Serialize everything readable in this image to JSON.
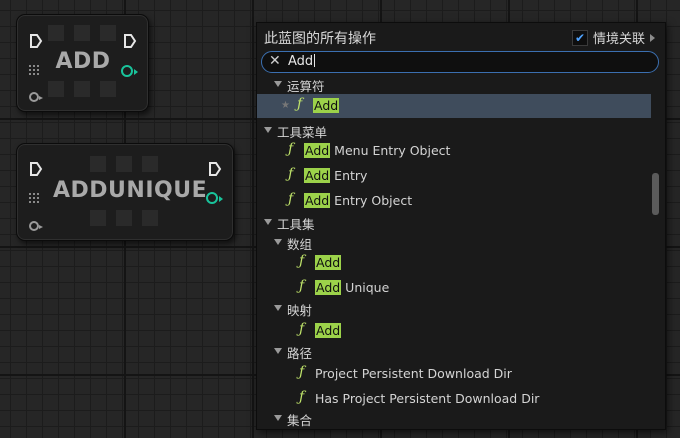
{
  "nodes": {
    "add": {
      "title": "ADD"
    },
    "addunique": {
      "title": "ADDUNIQUE"
    }
  },
  "menu": {
    "title": "此蓝图的所有操作",
    "context_label": "情境关联",
    "context_checked": true,
    "search": {
      "value": "Add"
    },
    "items": [
      {
        "type": "category",
        "label": "运算符"
      },
      {
        "type": "function",
        "match": "Add",
        "rest": "",
        "selected": true
      },
      {
        "type": "category",
        "label": "工具菜单"
      },
      {
        "type": "function",
        "match": "Add",
        "rest": " Menu Entry Object"
      },
      {
        "type": "function",
        "match": "Add",
        "rest": " Entry"
      },
      {
        "type": "function",
        "match": "Add",
        "rest": " Entry Object"
      },
      {
        "type": "category",
        "label": "工具集"
      },
      {
        "type": "category",
        "label": "数组"
      },
      {
        "type": "function",
        "match": "Add",
        "rest": ""
      },
      {
        "type": "function",
        "match": "Add",
        "rest": " Unique"
      },
      {
        "type": "category",
        "label": "映射"
      },
      {
        "type": "function",
        "match": "Add",
        "rest": ""
      },
      {
        "type": "category",
        "label": "路径"
      },
      {
        "type": "function",
        "label": "Project Persistent Download Dir"
      },
      {
        "type": "function",
        "label": "Has Project Persistent Download Dir"
      },
      {
        "type": "category",
        "label": "集合"
      }
    ]
  },
  "colors": {
    "highlight": "#9cd24a",
    "selected_row": "#3f4c5c",
    "function_icon": "#bfe36a",
    "output_pin": "#19c39b",
    "search_border": "#3b6fb0"
  },
  "icons": {
    "function": "function-f-icon",
    "expand": "triangle-down-icon",
    "clear": "close-icon",
    "favorite": "star-icon",
    "exec_pin": "exec-pin-icon",
    "output_pin": "circle-output-pin-icon"
  }
}
